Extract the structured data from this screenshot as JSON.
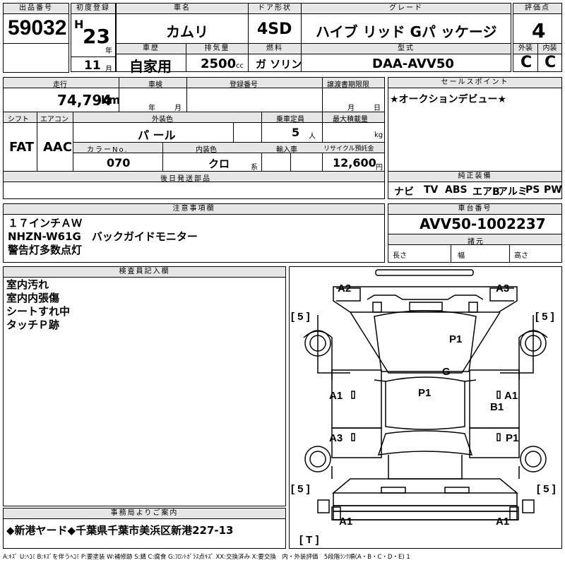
{
  "header": {
    "lot_label": "出品番号",
    "lot_no": "59032",
    "first_reg_label": "初度登録",
    "era": "H",
    "year": "23",
    "year_unit": "年",
    "month": "11",
    "month_unit": "月",
    "car_name_label": "車名",
    "car_name": "カムリ",
    "door_label": "ドア形状",
    "door": "4SD",
    "grade_label": "グレード",
    "grade": "ハイブ リッド Gパ ッケージ",
    "score_label": "評価点",
    "score": "4",
    "history_label": "車歴",
    "history": "自家用",
    "disp_label": "排気量",
    "disp": "2500",
    "disp_unit": "cc",
    "fuel_label": "燃料",
    "fuel": "ガ ソリン",
    "model_label": "型式",
    "model": "DAA-AVV50",
    "ext_label": "外装",
    "ext": "C",
    "int_label": "内装",
    "int": "C"
  },
  "spec": {
    "mileage_label": "走行",
    "mileage": "74,794",
    "mileage_unit": "km",
    "inspect_label": "車検",
    "inspect_year": "年",
    "inspect_month": "月",
    "reg_label": "登録番号",
    "transfer_label": "譲渡書期限限",
    "transfer_month": "月",
    "transfer_day": "日",
    "shift_label": "シフト",
    "shift": "FAT",
    "ac_label": "エアコン",
    "ac": "AAC",
    "color_label": "外装色",
    "color": "パ ール",
    "cap_label": "乗車定員",
    "cap": "5",
    "cap_unit": "人",
    "load_label": "最大積載量",
    "load_unit": "kg",
    "colorno_label": "カラーNo.",
    "colorno": "070",
    "intcolor_label": "内装色",
    "intcolor": "クロ",
    "intcolor_unit": "系",
    "import_label": "輸入車",
    "recycle_label": "リサイクル預託金",
    "recycle": "12,600",
    "recycle_unit": "円",
    "later_label": "後日発送部品"
  },
  "sales": {
    "label": "セールスポイント",
    "text": "★オークションデビュー★"
  },
  "equip": {
    "label": "純正装備",
    "items": [
      "ナビ",
      "TV",
      "ABS",
      "エアB",
      "アルミ",
      "PS",
      "PW"
    ]
  },
  "notes": {
    "label": "注意事項欄",
    "lines": [
      "１７インチＡＷ",
      "NHZN-W61G　バックガイドモニター",
      "警告灯多数点灯"
    ]
  },
  "chassis": {
    "label": "車台番号",
    "value": "AVV50-1002237",
    "dim_label": "諸元",
    "len": "長さ",
    "wid": "幅",
    "hei": "高さ"
  },
  "inspector": {
    "label": "検査員記入欄",
    "lines": [
      "室内汚れ",
      "室内内張傷",
      "シートすれ中",
      "タッチＰ跡"
    ]
  },
  "office": {
    "label": "事務局よりご案内",
    "text": "◆新港ヤード◆千葉県千葉市美浜区新港227-13"
  },
  "legend": "A:ｷｽﾞ U:ﾍｺﾐ B:ｷｽﾞを伴うﾍｺﾐ P:要塗装 W:補修跡 S:錆 C:腐食 G:ﾌﾛﾝﾄｶﾞﾗｽ点ｷｽﾞ XX:交換済み X:要交換　内・外装評価　5段階ﾗﾝｸ順(A・B・C・D・E) 1",
  "diagram": {
    "marks": [
      "A2",
      "A3",
      "P1",
      "G",
      "P1",
      "A1",
      "A1",
      "B1",
      "A3",
      "P1",
      "A1",
      "A1"
    ],
    "tires": [
      "[ 5 ]",
      "[ 5 ]",
      "[ 5 ]",
      "[ 5 ]"
    ],
    "tire_unit": "[ T ]"
  }
}
